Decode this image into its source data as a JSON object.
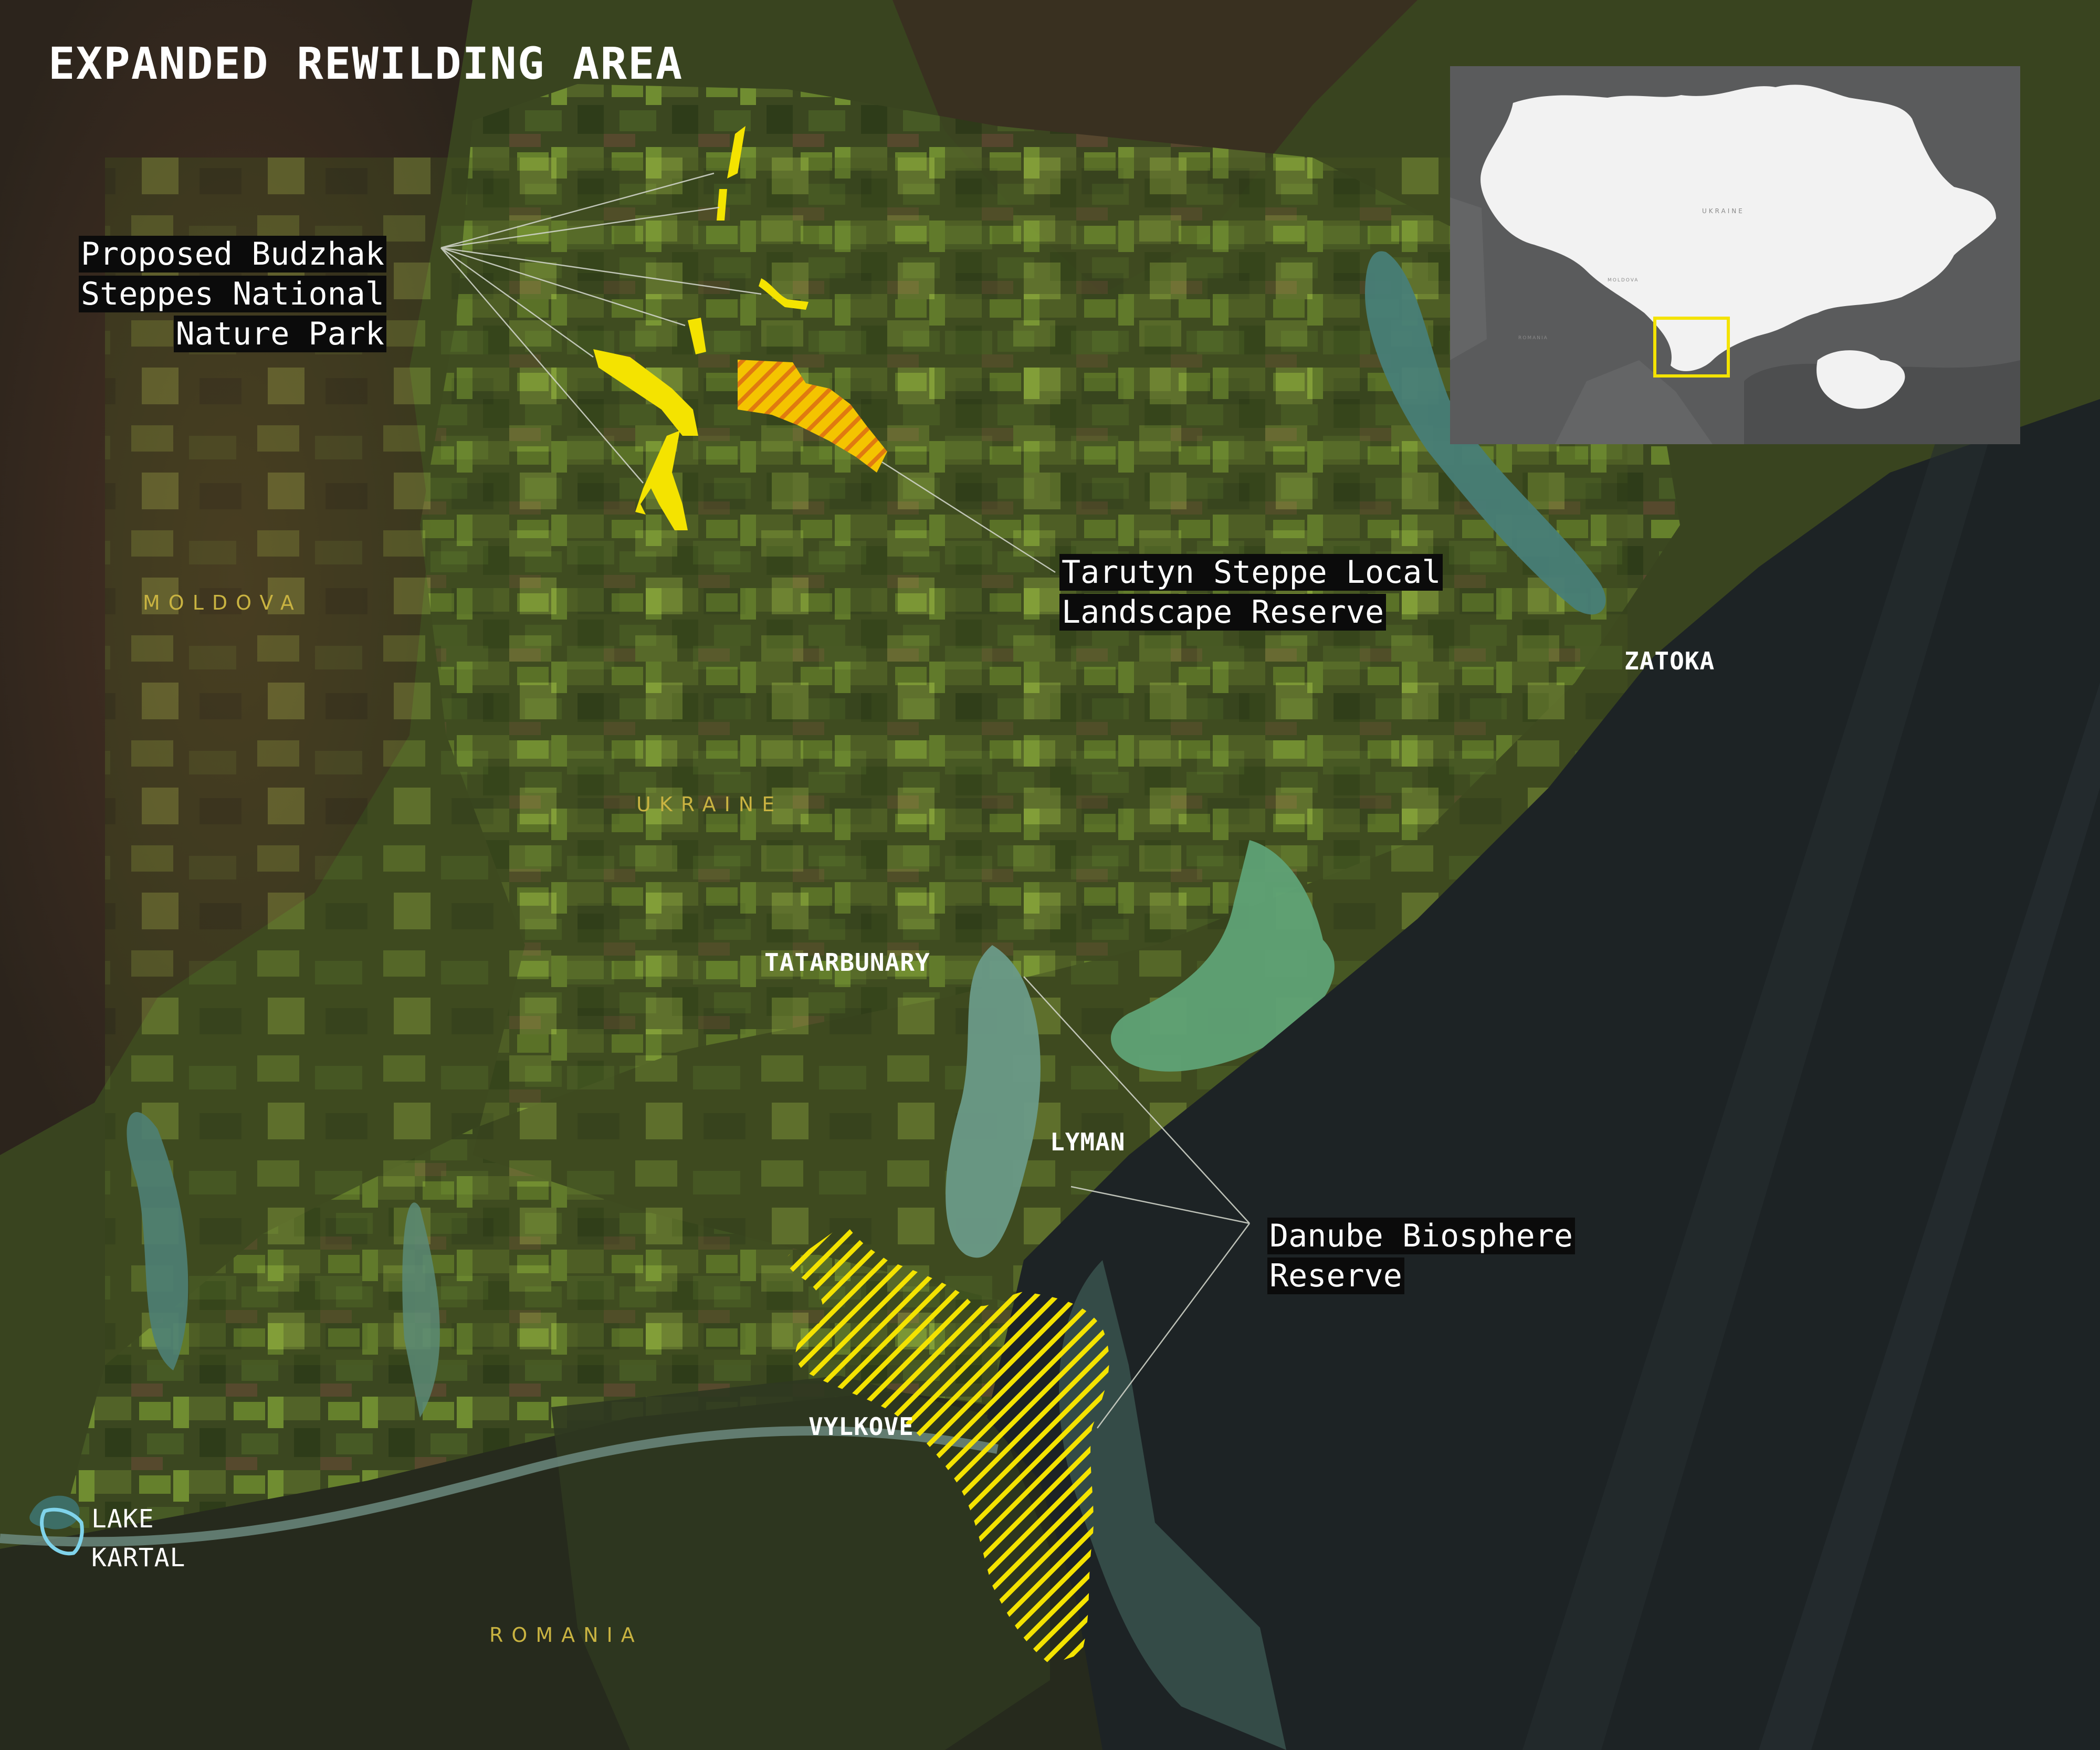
{
  "title": "EXPANDED REWILDING AREA",
  "callouts": {
    "budzhak": [
      "Proposed Budzhak",
      "Steppes National",
      "Nature Park"
    ],
    "tarutyn": [
      "Tarutyn Steppe Local",
      "Landscape Reserve"
    ],
    "danube": [
      "Danube Biosphere",
      "Reserve"
    ]
  },
  "country_labels": {
    "moldova": "MOLDOVA",
    "ukraine": "UKRAINE",
    "romania": "ROMANIA"
  },
  "towns": {
    "zatoka": "ZATOKA",
    "tatarbunary": "TATARBUNARY",
    "lyman": "LYMAN",
    "vylkove": "VYLKOVE"
  },
  "lake_kartal": [
    "LAKE",
    "KARTAL"
  ],
  "inset": {
    "ukraine": "UKRAINE",
    "moldova": "MOLDOVA",
    "romania": "ROMANIA"
  },
  "colors": {
    "protected_area_yellow": "#f4e300",
    "hatch_orange": "#e07a10",
    "lake_outline": "#7fd3ea",
    "sea": "#1d2325",
    "land": "#3d4a20",
    "inset_background": "#5a5b5c",
    "inset_land": "#f2f2f2"
  }
}
